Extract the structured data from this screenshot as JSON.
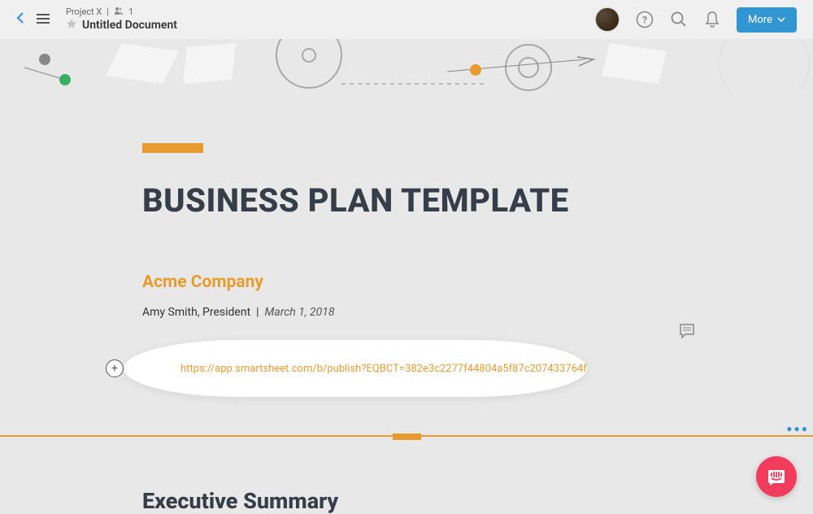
{
  "header": {
    "project_name": "Project X",
    "user_count": "1",
    "doc_title": "Untitled Document",
    "more_label": "More"
  },
  "document": {
    "title": "BUSINESS PLAN TEMPLATE",
    "company": "Acme Company",
    "author": "Amy Smith, President",
    "separator": "|",
    "date": "March 1, 2018",
    "url": "https://app.smartsheet.com/b/publish?EQBCT=382e3c2277f44804a5f87c207433764f",
    "section2_title": "Executive Summary"
  },
  "colors": {
    "accent": "#e89b2e",
    "primary": "#3296d3",
    "fab": "#f13c5c"
  }
}
